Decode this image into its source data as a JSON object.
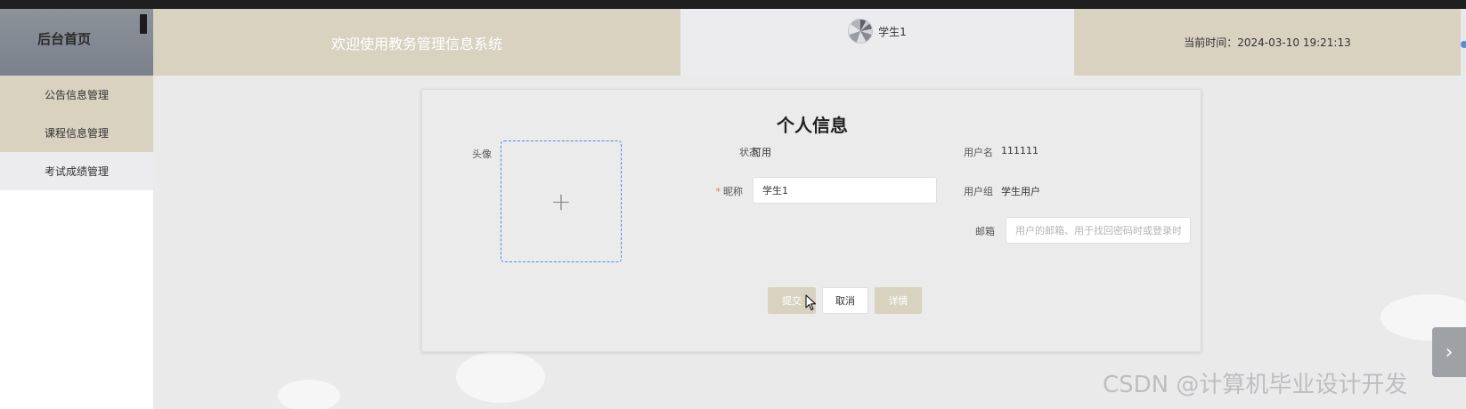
{
  "header": {
    "logo_title": "后台首页",
    "welcome": "欢迎使用教务管理信息系统",
    "user_name": "学生1",
    "current_time": "当前时间：2024-03-10 19:21:13"
  },
  "sidebar": {
    "items": [
      {
        "label": "公告信息管理"
      },
      {
        "label": "课程信息管理"
      },
      {
        "label": "考试成绩管理"
      }
    ]
  },
  "profile": {
    "title": "个人信息",
    "avatar_label": "头像",
    "status_label": "状态",
    "status_value": "可用",
    "nickname_label": "昵称",
    "nickname_value": "学生1",
    "username_label": "用户名",
    "username_value": "111111",
    "group_label": "用户组",
    "group_value": "学生用户",
    "email_label": "邮箱",
    "email_placeholder": "用户的邮箱、用于找回密码时或登录时",
    "buttons": {
      "submit": "提交",
      "cancel": "取消",
      "detail": "详情"
    }
  },
  "watermark": "CSDN @计算机毕业设计开发",
  "colors": {
    "accent": "#d9d2c1",
    "logo_bg": "#8c929a",
    "upload_border": "#3f8ee8",
    "required": "#f56c6c"
  }
}
